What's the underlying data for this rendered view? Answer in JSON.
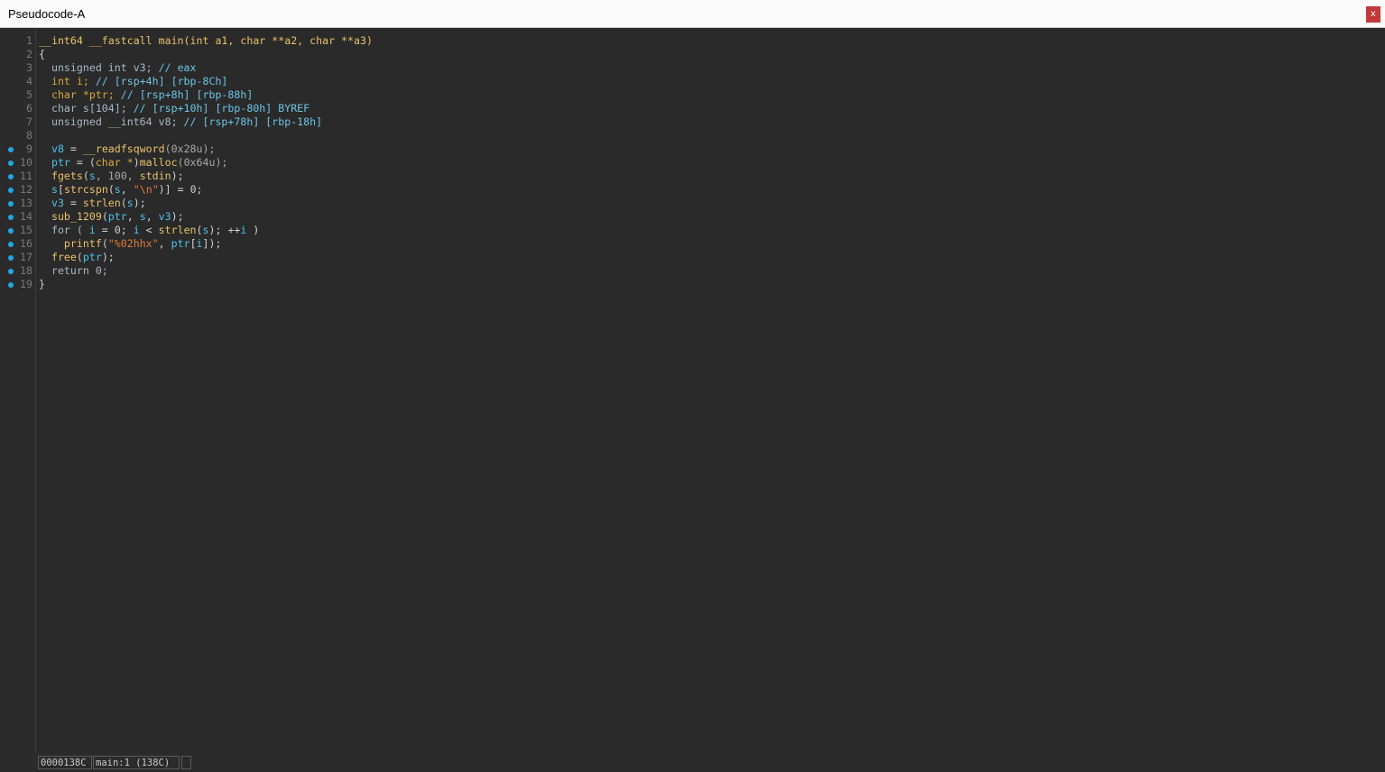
{
  "window": {
    "title": "Pseudocode-A",
    "close_label": "x"
  },
  "code_lines": [
    {
      "num": "1",
      "breakpoint": false,
      "tokens": [
        {
          "t": "__int64 __fastcall main(int a1, char **a2, char **a3)",
          "c": "t-func"
        }
      ]
    },
    {
      "num": "2",
      "breakpoint": false,
      "tokens": [
        {
          "t": "{",
          "c": "t-plain"
        }
      ]
    },
    {
      "num": "3",
      "breakpoint": false,
      "tokens": [
        {
          "t": "  unsigned int v3; ",
          "c": "t-kw"
        },
        {
          "t": "// eax",
          "c": "t-cmt"
        }
      ]
    },
    {
      "num": "4",
      "breakpoint": false,
      "tokens": [
        {
          "t": "  int i; ",
          "c": "t-type"
        },
        {
          "t": "// [rsp+4h] [rbp-8Ch]",
          "c": "t-cmt"
        }
      ]
    },
    {
      "num": "5",
      "breakpoint": false,
      "tokens": [
        {
          "t": "  char *ptr; ",
          "c": "t-type"
        },
        {
          "t": "// [rsp+8h] [rbp-88h]",
          "c": "t-cmt"
        }
      ]
    },
    {
      "num": "6",
      "breakpoint": false,
      "tokens": [
        {
          "t": "  char s[104]; ",
          "c": "t-kw"
        },
        {
          "t": "// [rsp+10h] [rbp-80h] BYREF",
          "c": "t-cmt"
        }
      ]
    },
    {
      "num": "7",
      "breakpoint": false,
      "tokens": [
        {
          "t": "  unsigned __int64 v8; ",
          "c": "t-kw"
        },
        {
          "t": "// [rsp+78h] [rbp-18h]",
          "c": "t-cmt"
        }
      ]
    },
    {
      "num": "8",
      "breakpoint": false,
      "tokens": []
    },
    {
      "num": "9",
      "breakpoint": true,
      "tokens": [
        {
          "t": "  v8",
          "c": "t-var"
        },
        {
          "t": " = ",
          "c": "t-plain"
        },
        {
          "t": "__readfsqword",
          "c": "t-func"
        },
        {
          "t": "(0x28u);",
          "c": "t-num"
        }
      ]
    },
    {
      "num": "10",
      "breakpoint": true,
      "tokens": [
        {
          "t": "  ptr",
          "c": "t-var"
        },
        {
          "t": " = (",
          "c": "t-plain"
        },
        {
          "t": "char *",
          "c": "t-type"
        },
        {
          "t": ")",
          "c": "t-plain"
        },
        {
          "t": "malloc",
          "c": "t-func"
        },
        {
          "t": "(0x64u);",
          "c": "t-num"
        }
      ]
    },
    {
      "num": "11",
      "breakpoint": true,
      "tokens": [
        {
          "t": "  fgets",
          "c": "t-func"
        },
        {
          "t": "(",
          "c": "t-plain"
        },
        {
          "t": "s",
          "c": "t-var"
        },
        {
          "t": ", 100, ",
          "c": "t-num"
        },
        {
          "t": "stdin",
          "c": "t-func"
        },
        {
          "t": ");",
          "c": "t-plain"
        }
      ]
    },
    {
      "num": "12",
      "breakpoint": true,
      "tokens": [
        {
          "t": "  s",
          "c": "t-var"
        },
        {
          "t": "[",
          "c": "t-plain"
        },
        {
          "t": "strcspn",
          "c": "t-func"
        },
        {
          "t": "(",
          "c": "t-plain"
        },
        {
          "t": "s",
          "c": "t-var"
        },
        {
          "t": ", ",
          "c": "t-plain"
        },
        {
          "t": "\"\\n\"",
          "c": "t-str"
        },
        {
          "t": ")] = 0;",
          "c": "t-plain"
        }
      ]
    },
    {
      "num": "13",
      "breakpoint": true,
      "tokens": [
        {
          "t": "  v3",
          "c": "t-var"
        },
        {
          "t": " = ",
          "c": "t-plain"
        },
        {
          "t": "strlen",
          "c": "t-func"
        },
        {
          "t": "(",
          "c": "t-plain"
        },
        {
          "t": "s",
          "c": "t-var"
        },
        {
          "t": ");",
          "c": "t-plain"
        }
      ]
    },
    {
      "num": "14",
      "breakpoint": true,
      "tokens": [
        {
          "t": "  sub_1209",
          "c": "t-func"
        },
        {
          "t": "(",
          "c": "t-plain"
        },
        {
          "t": "ptr",
          "c": "t-var"
        },
        {
          "t": ", ",
          "c": "t-plain"
        },
        {
          "t": "s",
          "c": "t-var"
        },
        {
          "t": ", ",
          "c": "t-plain"
        },
        {
          "t": "v3",
          "c": "t-var"
        },
        {
          "t": ");",
          "c": "t-plain"
        }
      ]
    },
    {
      "num": "15",
      "breakpoint": true,
      "tokens": [
        {
          "t": "  for ( ",
          "c": "t-kw"
        },
        {
          "t": "i",
          "c": "t-var"
        },
        {
          "t": " = 0; ",
          "c": "t-plain"
        },
        {
          "t": "i",
          "c": "t-var"
        },
        {
          "t": " < ",
          "c": "t-plain"
        },
        {
          "t": "strlen",
          "c": "t-func"
        },
        {
          "t": "(",
          "c": "t-plain"
        },
        {
          "t": "s",
          "c": "t-var"
        },
        {
          "t": "); ++",
          "c": "t-plain"
        },
        {
          "t": "i",
          "c": "t-var"
        },
        {
          "t": " )",
          "c": "t-plain"
        }
      ]
    },
    {
      "num": "16",
      "breakpoint": true,
      "tokens": [
        {
          "t": "    printf",
          "c": "t-func"
        },
        {
          "t": "(",
          "c": "t-plain"
        },
        {
          "t": "\"%02hhx\"",
          "c": "t-str"
        },
        {
          "t": ", ",
          "c": "t-plain"
        },
        {
          "t": "ptr",
          "c": "t-var"
        },
        {
          "t": "[",
          "c": "t-plain"
        },
        {
          "t": "i",
          "c": "t-var"
        },
        {
          "t": "]);",
          "c": "t-plain"
        }
      ]
    },
    {
      "num": "17",
      "breakpoint": true,
      "tokens": [
        {
          "t": "  free",
          "c": "t-func"
        },
        {
          "t": "(",
          "c": "t-plain"
        },
        {
          "t": "ptr",
          "c": "t-var"
        },
        {
          "t": ");",
          "c": "t-plain"
        }
      ]
    },
    {
      "num": "18",
      "breakpoint": true,
      "tokens": [
        {
          "t": "  return 0;",
          "c": "t-kw"
        }
      ]
    },
    {
      "num": "19",
      "breakpoint": true,
      "tokens": [
        {
          "t": "}",
          "c": "t-plain"
        }
      ]
    }
  ],
  "status": {
    "address": "0000138C",
    "location": "main:1 (138C)",
    "extra": ""
  },
  "colors": {
    "background": "#2b2b2b",
    "breakpoint_dot": "#1fa7e8",
    "close_button": "#c3393b"
  }
}
